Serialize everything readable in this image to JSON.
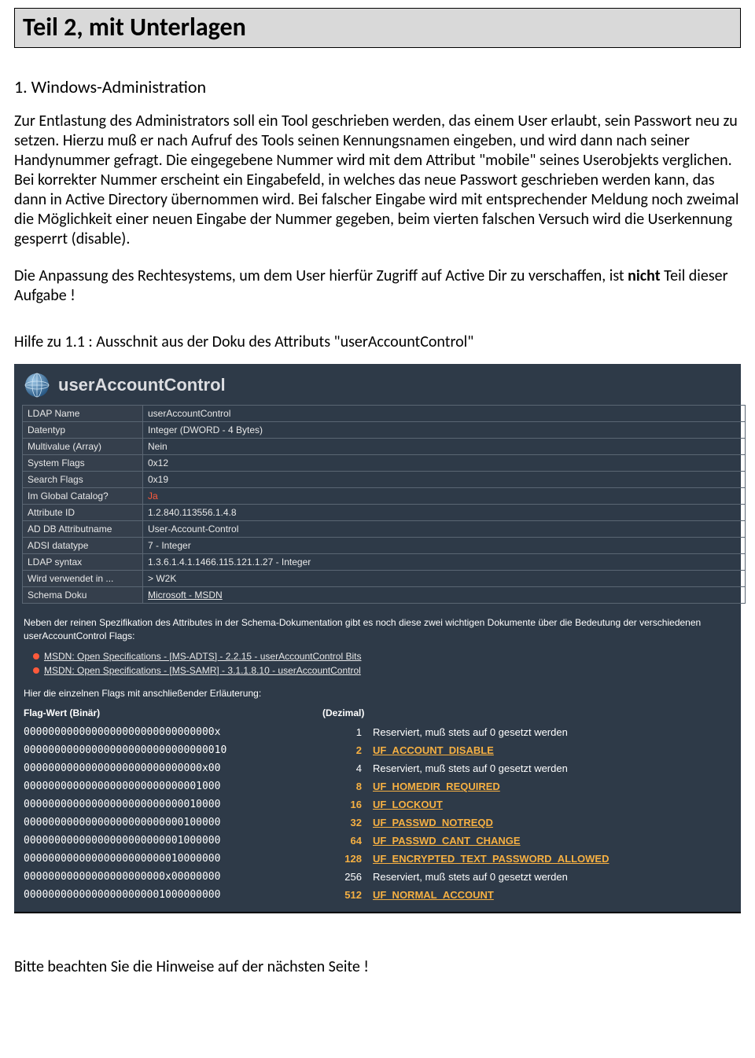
{
  "title": "Teil 2, mit Unterlagen",
  "section_heading": "1. Windows-Administration",
  "para1": "Zur Entlastung des Administrators soll ein Tool geschrieben werden, das einem User erlaubt, sein Passwort neu zu setzen. Hierzu muß er nach Aufruf des Tools seinen Kennungsnamen eingeben, und wird dann nach seiner Handynummer gefragt. Die eingegebene Nummer wird mit dem Attribut \"mobile\" seines Userobjekts verglichen. Bei korrekter Nummer erscheint ein Eingabefeld, in welches das neue Passwort geschrieben werden kann, das dann in Active Directory übernommen wird. Bei falscher Eingabe wird mit entsprechender Meldung noch zweimal die Möglichkeit einer neuen Eingabe der Nummer gegeben, beim vierten falschen Versuch wird die Userkennung gesperrt (disable).",
  "para2_pre": "Die Anpassung des Rechtesystems, um dem User hierfür Zugriff auf Active Dir zu verschaffen, ist ",
  "para2_bold": "nicht",
  "para2_post": " Teil dieser Aufgabe !",
  "help_heading": "Hilfe zu 1.1 : Ausschnit aus der Doku des Attributs \"userAccountControl\"",
  "panel": {
    "title": "userAccountControl",
    "rows": [
      {
        "k": "LDAP Name",
        "v": "userAccountControl"
      },
      {
        "k": "Datentyp",
        "v": "Integer (DWORD - 4 Bytes)"
      },
      {
        "k": "Multivalue (Array)",
        "v": "Nein"
      },
      {
        "k": "System Flags",
        "v": "0x12"
      },
      {
        "k": "Search Flags",
        "v": "0x19"
      },
      {
        "k": "Im Global Catalog?",
        "v": "Ja",
        "red": true
      },
      {
        "k": "Attribute ID",
        "v": "1.2.840.113556.1.4.8"
      },
      {
        "k": "AD DB Attributname",
        "v": "User-Account-Control"
      },
      {
        "k": "ADSI datatype",
        "v": "7 - Integer"
      },
      {
        "k": "LDAP syntax",
        "v": "1.3.6.1.4.1.1466.115.121.1.27 - Integer"
      },
      {
        "k": "Wird verwendet in ...",
        "v": "> W2K"
      },
      {
        "k": "Schema Doku",
        "v": "Microsoft - MSDN",
        "uline": true
      }
    ],
    "note": "Neben der reinen Spezifikation des Attributes in der Schema-Dokumentation gibt es noch diese zwei wichtigen Dokumente über die Bedeutung der verschiedenen userAccountControl Flags:",
    "links": [
      "MSDN: Open Specifications - [MS-ADTS] - 2.2.15 - userAccountControl Bits",
      "MSDN: Open Specifications - [MS-SAMR] - 3.1.1.8.10 - userAccountControl"
    ],
    "intro": "Hier die einzelnen Flags mit anschließender Erläuterung:",
    "head_bin": "Flag-Wert (Binär)",
    "head_dec": "(Dezimal)",
    "flags": [
      {
        "bin": "0000000000000000000000000000000x",
        "dec": "1",
        "desc": "Reserviert, muß stets auf 0 gesetzt werden",
        "em": false
      },
      {
        "bin": "000000000000000000000000000000010",
        "dec": "2",
        "desc": "UF_ACCOUNT_DISABLE",
        "em": true
      },
      {
        "bin": "00000000000000000000000000000x00",
        "dec": "4",
        "desc": "Reserviert, muß stets auf 0 gesetzt werden",
        "em": false
      },
      {
        "bin": "00000000000000000000000000001000",
        "dec": "8",
        "desc": "UF_HOMEDIR_REQUIRED",
        "em": true
      },
      {
        "bin": "00000000000000000000000000010000",
        "dec": "16",
        "desc": "UF_LOCKOUT",
        "em": true
      },
      {
        "bin": "00000000000000000000000000100000",
        "dec": "32",
        "desc": "UF_PASSWD_NOTREQD",
        "em": true
      },
      {
        "bin": "00000000000000000000000001000000",
        "dec": "64",
        "desc": "UF_PASSWD_CANT_CHANGE",
        "em": true
      },
      {
        "bin": "00000000000000000000000010000000",
        "dec": "128",
        "desc": "UF_ENCRYPTED_TEXT_PASSWORD_ALLOWED",
        "em": true
      },
      {
        "bin": "00000000000000000000000x00000000",
        "dec": "256",
        "desc": "Reserviert, muß stets auf 0 gesetzt werden",
        "em": false
      },
      {
        "bin": "00000000000000000000001000000000",
        "dec": "512",
        "desc": "UF_NORMAL_ACCOUNT",
        "em": true
      }
    ]
  },
  "footer": "Bitte beachten Sie die Hinweise auf der nächsten Seite !"
}
